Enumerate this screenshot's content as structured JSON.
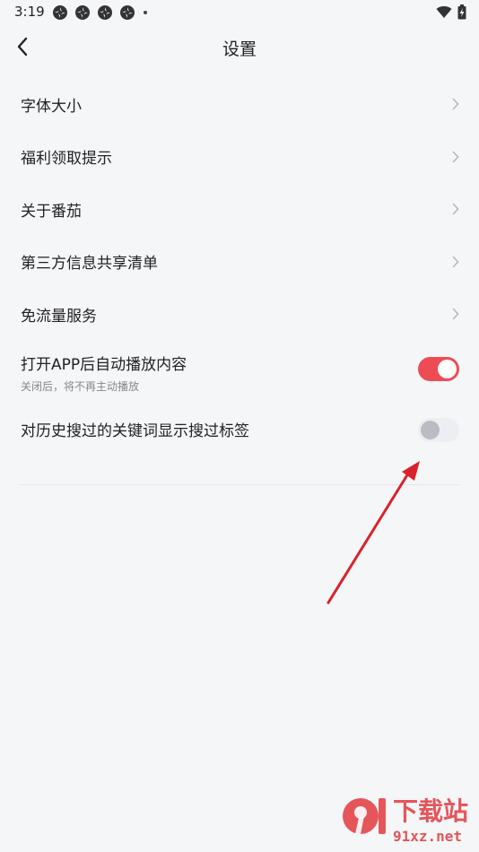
{
  "status_bar": {
    "time": "3:19"
  },
  "header": {
    "title": "设置"
  },
  "settings": {
    "items": [
      {
        "label": "字体大小"
      },
      {
        "label": "福利领取提示"
      },
      {
        "label": "关于番茄"
      },
      {
        "label": "第三方信息共享清单"
      },
      {
        "label": "免流量服务"
      }
    ],
    "autoplay": {
      "label": "打开APP后自动播放内容",
      "subtitle": "关闭后，将不再主动播放",
      "enabled": true
    },
    "search_history_tag": {
      "label": "对历史搜过的关键词显示搜过标签",
      "enabled": false
    }
  },
  "colors": {
    "accent": "#ee4c55",
    "annotation_arrow": "#d9222a"
  },
  "watermark": {
    "logo_text": "下载站",
    "site": "91xz.net"
  }
}
